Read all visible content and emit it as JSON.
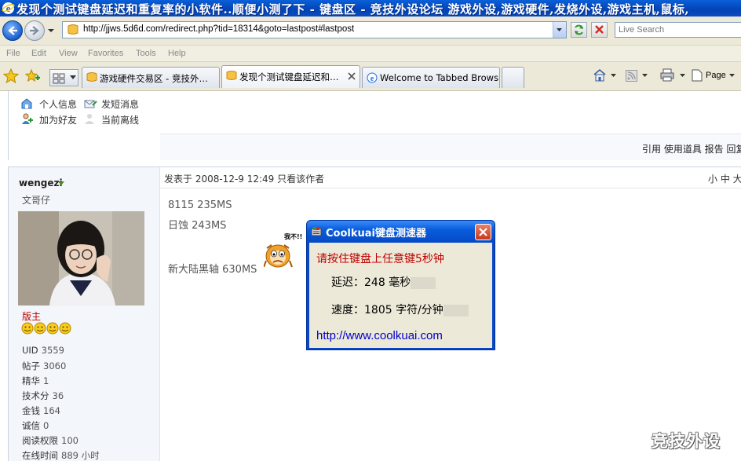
{
  "window": {
    "title": "发现个测试键盘延迟和重复率的小软件..顺便小测了下 - 键盘区 - 竞技外设论坛 游戏外设,游戏硬件,发烧外设,游戏主机,鼠标,"
  },
  "address_bar": {
    "url": "http://jjws.5d6d.com/redirect.php?tid=18314&goto=lastpost#lastpost",
    "search_placeholder": "Live Search"
  },
  "menu": {
    "items": [
      "File",
      "Edit",
      "View",
      "Favorites",
      "Tools",
      "Help"
    ]
  },
  "tabs": [
    {
      "label": "游戏硬件交易区 - 竞技外…",
      "active": false
    },
    {
      "label": "发现个测试键盘延迟和…",
      "active": true
    },
    {
      "label": "Welcome to Tabbed Browsing",
      "active": false
    }
  ],
  "toolbar_right": {
    "page_label": "Page"
  },
  "top_user_links": {
    "profile": "个人信息",
    "send_pm": "发短消息",
    "add_friend": "加为好友",
    "status": "当前离线"
  },
  "post_actions": "引用 使用道具 报告 回复",
  "post": {
    "author": "wengezi",
    "author_title": "文哥仔",
    "rank": "版主",
    "stats": [
      {
        "label": "UID",
        "value": "3559"
      },
      {
        "label": "帖子",
        "value": "3060"
      },
      {
        "label": "精华",
        "value": "1"
      },
      {
        "label": "技术分",
        "value": "36"
      },
      {
        "label": "金钱",
        "value": "164"
      },
      {
        "label": "诚信",
        "value": "0"
      },
      {
        "label": "阅读权限",
        "value": "100"
      },
      {
        "label": "在线时间",
        "value": "889 小时"
      }
    ],
    "posted_info": "发表于 2008-12-9 12:49  只看该作者",
    "font_size_controls": "小 中 大",
    "lines": [
      "8115  235MS",
      "日蚀 243MS",
      "新大陆黑轴  630MS"
    ],
    "emoticon_caption": "我不!!"
  },
  "popup": {
    "title": "Coolkuai键盘测速器",
    "prompt": "请按住键盘上任意键5秒钟",
    "delay_label": "延迟：",
    "delay_value": "248",
    "delay_unit": "毫秒",
    "speed_label": "速度：",
    "speed_value": "1805",
    "speed_unit": "字符/分钟",
    "link": "http://www.coolkuai.com"
  },
  "watermark": "竞技外设"
}
